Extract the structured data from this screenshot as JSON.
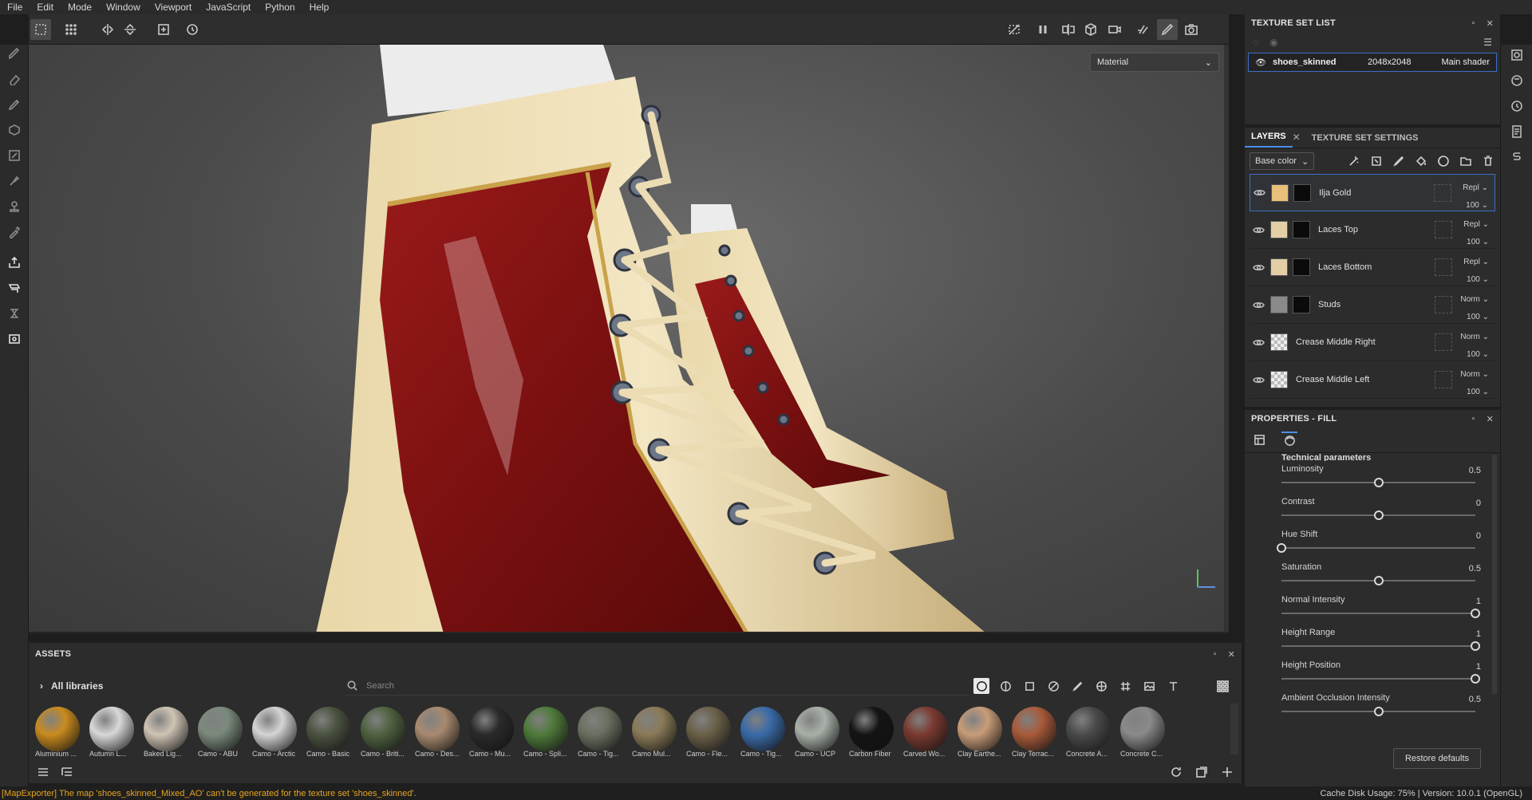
{
  "menu": [
    "File",
    "Edit",
    "Mode",
    "Window",
    "Viewport",
    "JavaScript",
    "Python",
    "Help"
  ],
  "viewport": {
    "display_mode": "Material"
  },
  "texture_set_list": {
    "title": "TEXTURE SET LIST",
    "row": {
      "name": "shoes_skinned",
      "resolution": "2048x2048",
      "shader": "Main shader"
    }
  },
  "layers_panel": {
    "tab_layers": "LAYERS",
    "tab_settings": "TEXTURE SET SETTINGS",
    "channel": "Base color",
    "layers": [
      {
        "name": "Ilja Gold",
        "blend": "Repl",
        "opacity": "100",
        "thumb": "#e8c07a",
        "selected": true
      },
      {
        "name": "Laces Top",
        "blend": "Repl",
        "opacity": "100",
        "thumb": "#e2cfa6",
        "selected": false
      },
      {
        "name": "Laces Bottom",
        "blend": "Repl",
        "opacity": "100",
        "thumb": "#e2cfa6",
        "selected": false
      },
      {
        "name": "Studs",
        "blend": "Norm",
        "opacity": "100",
        "thumb": "#8a8a8a",
        "selected": false
      },
      {
        "name": "Crease Middle Right",
        "blend": "Norm",
        "opacity": "100",
        "thumb": "checker",
        "selected": false
      },
      {
        "name": "Crease Middle Left",
        "blend": "Norm",
        "opacity": "100",
        "thumb": "checker",
        "selected": false
      }
    ]
  },
  "properties": {
    "title": "PROPERTIES - FILL",
    "section": "Technical parameters",
    "params": [
      {
        "label": "Luminosity",
        "value": "0.5",
        "pos": 0.5
      },
      {
        "label": "Contrast",
        "value": "0",
        "pos": 0.5
      },
      {
        "label": "Hue Shift",
        "value": "0",
        "pos": 0.0
      },
      {
        "label": "Saturation",
        "value": "0.5",
        "pos": 0.5
      },
      {
        "label": "Normal Intensity",
        "value": "1",
        "pos": 1.0
      },
      {
        "label": "Height Range",
        "value": "1",
        "pos": 1.0
      },
      {
        "label": "Height Position",
        "value": "1",
        "pos": 1.0
      },
      {
        "label": "Ambient Occlusion Intensity",
        "value": "0.5",
        "pos": 0.5
      }
    ],
    "restore_label": "Restore defaults"
  },
  "assets": {
    "title": "ASSETS",
    "library": "All libraries",
    "search_placeholder": "Search",
    "items": [
      {
        "name": "Aluminium ...",
        "color": "#c98b1e"
      },
      {
        "name": "Autumn L...",
        "color": "#d8d8d8"
      },
      {
        "name": "Baked Lig...",
        "color": "#cfc4b4"
      },
      {
        "name": "Camo - ABU",
        "color": "#7b8a7c"
      },
      {
        "name": "Camo - Arctic",
        "color": "#d4d4d4"
      },
      {
        "name": "Camo - Basic",
        "color": "#4a5240"
      },
      {
        "name": "Camo - Briti...",
        "color": "#4f6240"
      },
      {
        "name": "Camo - Des...",
        "color": "#a88a70"
      },
      {
        "name": "Camo - Mu...",
        "color": "#2a2a2a"
      },
      {
        "name": "Camo - Spli...",
        "color": "#4e7a3a"
      },
      {
        "name": "Camo - Tig...",
        "color": "#6a7060"
      },
      {
        "name": "Camo Mul...",
        "color": "#8a7a58"
      },
      {
        "name": "Camo - Fle...",
        "color": "#6a6048"
      },
      {
        "name": "Camo - Tig...",
        "color": "#3a6aa8"
      },
      {
        "name": "Camo - UCP",
        "color": "#a8b0a8"
      },
      {
        "name": "Carbon Fiber",
        "color": "#141414"
      },
      {
        "name": "Carved Wo...",
        "color": "#7a3a30"
      },
      {
        "name": "Clay Earthe...",
        "color": "#c89c78"
      },
      {
        "name": "Clay Terrac...",
        "color": "#a85a3a"
      },
      {
        "name": "Concrete A...",
        "color": "#4a4a4a"
      },
      {
        "name": "Concrete C...",
        "color": "#8a8a8a"
      }
    ]
  },
  "status": {
    "error": "[MapExporter] The map 'shoes_skinned_Mixed_AO' can't be generated for the texture set 'shoes_skinned'.",
    "info": "Cache Disk Usage:   75% | Version: 10.0.1 (OpenGL)"
  }
}
